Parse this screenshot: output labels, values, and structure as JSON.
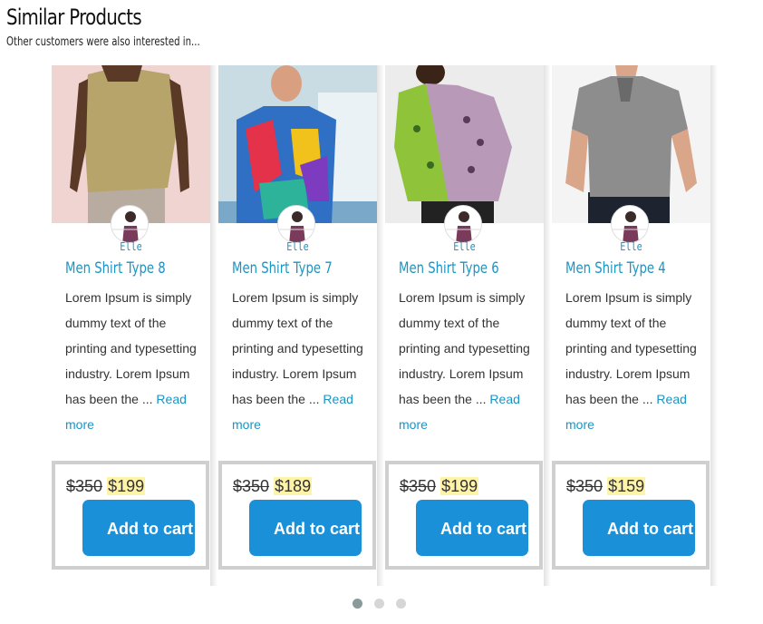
{
  "section": {
    "title": "Similar Products",
    "subtitle": "Other customers were also interested in..."
  },
  "products": [
    {
      "brand": "Elle",
      "name": "Men Shirt Type 8",
      "description": "Lorem Ipsum is simply dummy text of the printing and typesetting industry. Lorem Ipsum has been the ...",
      "read_more": "Read more",
      "old_price": "$350",
      "price": "$199",
      "add_to_cart": "Add to cart",
      "image_colors": {
        "bg": "#f0d4d2",
        "shirt": "#b7a46a",
        "skin": "#5a3a26",
        "pants": "#b8aba0"
      }
    },
    {
      "brand": "Elle",
      "name": "Men Shirt Type 7",
      "description": "Lorem Ipsum is simply dummy text of the printing and typesetting industry. Lorem Ipsum has been the ...",
      "read_more": "Read more",
      "old_price": "$350",
      "price": "$189",
      "add_to_cart": "Add to cart",
      "image_colors": {
        "bg": "#c9dbe3",
        "shirt": "#2f6fc4",
        "skin": "#d8a080",
        "pants": "#7aa8c8"
      }
    },
    {
      "brand": "Elle",
      "name": "Men Shirt Type 6",
      "description": "Lorem Ipsum is simply dummy text of the printing and typesetting industry. Lorem Ipsum has been the ...",
      "read_more": "Read more",
      "old_price": "$350",
      "price": "$199",
      "add_to_cart": "Add to cart",
      "image_colors": {
        "bg": "#ececec",
        "shirt": "#b89ab8",
        "skin": "#3a2418",
        "pants": "#222222"
      }
    },
    {
      "brand": "Elle",
      "name": "Men Shirt Type 4",
      "description": "Lorem Ipsum is simply dummy text of the printing and typesetting industry. Lorem Ipsum has been the ...",
      "read_more": "Read more",
      "old_price": "$350",
      "price": "$159",
      "add_to_cart": "Add to cart",
      "image_colors": {
        "bg": "#f4f4f4",
        "shirt": "#8d8d8d",
        "skin": "#d9a68a",
        "pants": "#1e2330"
      }
    }
  ],
  "pagination": {
    "pages": 3,
    "active": 0,
    "active_color": "#8a9a9a",
    "inactive_color": "#d6d6d6"
  },
  "colors": {
    "accent": "#1a95c4",
    "button": "#1a90d8",
    "price_highlight": "#fff3a8"
  }
}
